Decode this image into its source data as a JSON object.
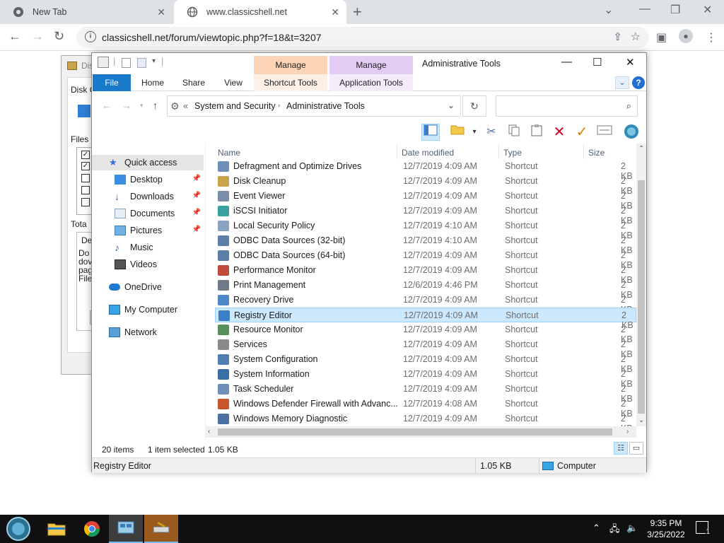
{
  "browser": {
    "tabs": [
      {
        "title": "New Tab"
      },
      {
        "title": "www.classicshell.net"
      }
    ],
    "url": "classicshell.net/forum/viewtopic.php?f=18&t=3207"
  },
  "bg_window": {
    "title_fragment": "Dis",
    "label_disk": "Disk C",
    "label_files": "Files",
    "label_total": "Tota",
    "label_desc": "De",
    "desc_lines": [
      "Do",
      "dov",
      "pag",
      "File"
    ]
  },
  "explorer": {
    "title": "Administrative Tools",
    "context_tabs": [
      {
        "group": "Manage",
        "tab": "Shortcut Tools",
        "color": "#fbd5b5"
      },
      {
        "group": "Manage",
        "tab": "Application Tools",
        "color": "#e4cdf5"
      }
    ],
    "ribbon_tabs": [
      "File",
      "Home",
      "Share",
      "View"
    ],
    "breadcrumb": [
      "System and Security",
      "Administrative Tools"
    ],
    "breadcrumb_prefix": "«",
    "nav": {
      "quick_access": "Quick access",
      "items": [
        {
          "label": "Desktop",
          "pinned": true,
          "icon": "desktop-icon"
        },
        {
          "label": "Downloads",
          "pinned": true,
          "icon": "downloads-icon"
        },
        {
          "label": "Documents",
          "pinned": true,
          "icon": "documents-icon"
        },
        {
          "label": "Pictures",
          "pinned": true,
          "icon": "pictures-icon"
        },
        {
          "label": "Music",
          "pinned": false,
          "icon": "music-icon"
        },
        {
          "label": "Videos",
          "pinned": false,
          "icon": "videos-icon"
        }
      ],
      "onedrive": "OneDrive",
      "my_computer": "My Computer",
      "network": "Network"
    },
    "columns": {
      "name": "Name",
      "date": "Date modified",
      "type": "Type",
      "size": "Size"
    },
    "files": [
      {
        "name": "Defragment and Optimize Drives",
        "date": "12/7/2019 4:09 AM",
        "type": "Shortcut",
        "size": "2 KB"
      },
      {
        "name": "Disk Cleanup",
        "date": "12/7/2019 4:09 AM",
        "type": "Shortcut",
        "size": "2 KB"
      },
      {
        "name": "Event Viewer",
        "date": "12/7/2019 4:09 AM",
        "type": "Shortcut",
        "size": "2 KB"
      },
      {
        "name": "iSCSI Initiator",
        "date": "12/7/2019 4:09 AM",
        "type": "Shortcut",
        "size": "2 KB"
      },
      {
        "name": "Local Security Policy",
        "date": "12/7/2019 4:10 AM",
        "type": "Shortcut",
        "size": "2 KB"
      },
      {
        "name": "ODBC Data Sources (32-bit)",
        "date": "12/7/2019 4:10 AM",
        "type": "Shortcut",
        "size": "2 KB"
      },
      {
        "name": "ODBC Data Sources (64-bit)",
        "date": "12/7/2019 4:09 AM",
        "type": "Shortcut",
        "size": "2 KB"
      },
      {
        "name": "Performance Monitor",
        "date": "12/7/2019 4:09 AM",
        "type": "Shortcut",
        "size": "2 KB"
      },
      {
        "name": "Print Management",
        "date": "12/6/2019 4:46 PM",
        "type": "Shortcut",
        "size": "2 KB"
      },
      {
        "name": "Recovery Drive",
        "date": "12/7/2019 4:09 AM",
        "type": "Shortcut",
        "size": "2 KB"
      },
      {
        "name": "Registry Editor",
        "date": "12/7/2019 4:09 AM",
        "type": "Shortcut",
        "size": "2 KB",
        "selected": true
      },
      {
        "name": "Resource Monitor",
        "date": "12/7/2019 4:09 AM",
        "type": "Shortcut",
        "size": "2 KB"
      },
      {
        "name": "Services",
        "date": "12/7/2019 4:09 AM",
        "type": "Shortcut",
        "size": "2 KB"
      },
      {
        "name": "System Configuration",
        "date": "12/7/2019 4:09 AM",
        "type": "Shortcut",
        "size": "2 KB"
      },
      {
        "name": "System Information",
        "date": "12/7/2019 4:09 AM",
        "type": "Shortcut",
        "size": "2 KB"
      },
      {
        "name": "Task Scheduler",
        "date": "12/7/2019 4:09 AM",
        "type": "Shortcut",
        "size": "2 KB"
      },
      {
        "name": "Windows Defender Firewall with Advanc...",
        "date": "12/7/2019 4:08 AM",
        "type": "Shortcut",
        "size": "2 KB"
      },
      {
        "name": "Windows Memory Diagnostic",
        "date": "12/7/2019 4:09 AM",
        "type": "Shortcut",
        "size": "2 KB"
      }
    ],
    "status": {
      "item_count": "20 items",
      "selection": "1 item selected",
      "selection_size": "1.05 KB",
      "bar_name": "Registry Editor",
      "bar_size": "1.05 KB",
      "bar_location": "Computer"
    }
  },
  "taskbar": {
    "time": "9:35 PM",
    "date": "3/25/2022",
    "notification_count": "1",
    "apps": [
      "start-orb-icon",
      "file-explorer-icon",
      "chrome-icon",
      "control-panel-icon",
      "disk-cleanup-icon"
    ]
  },
  "colors": {
    "selection_bg": "#cce8ff",
    "file_tab": "#1979ca",
    "taskbar": "#101010"
  }
}
